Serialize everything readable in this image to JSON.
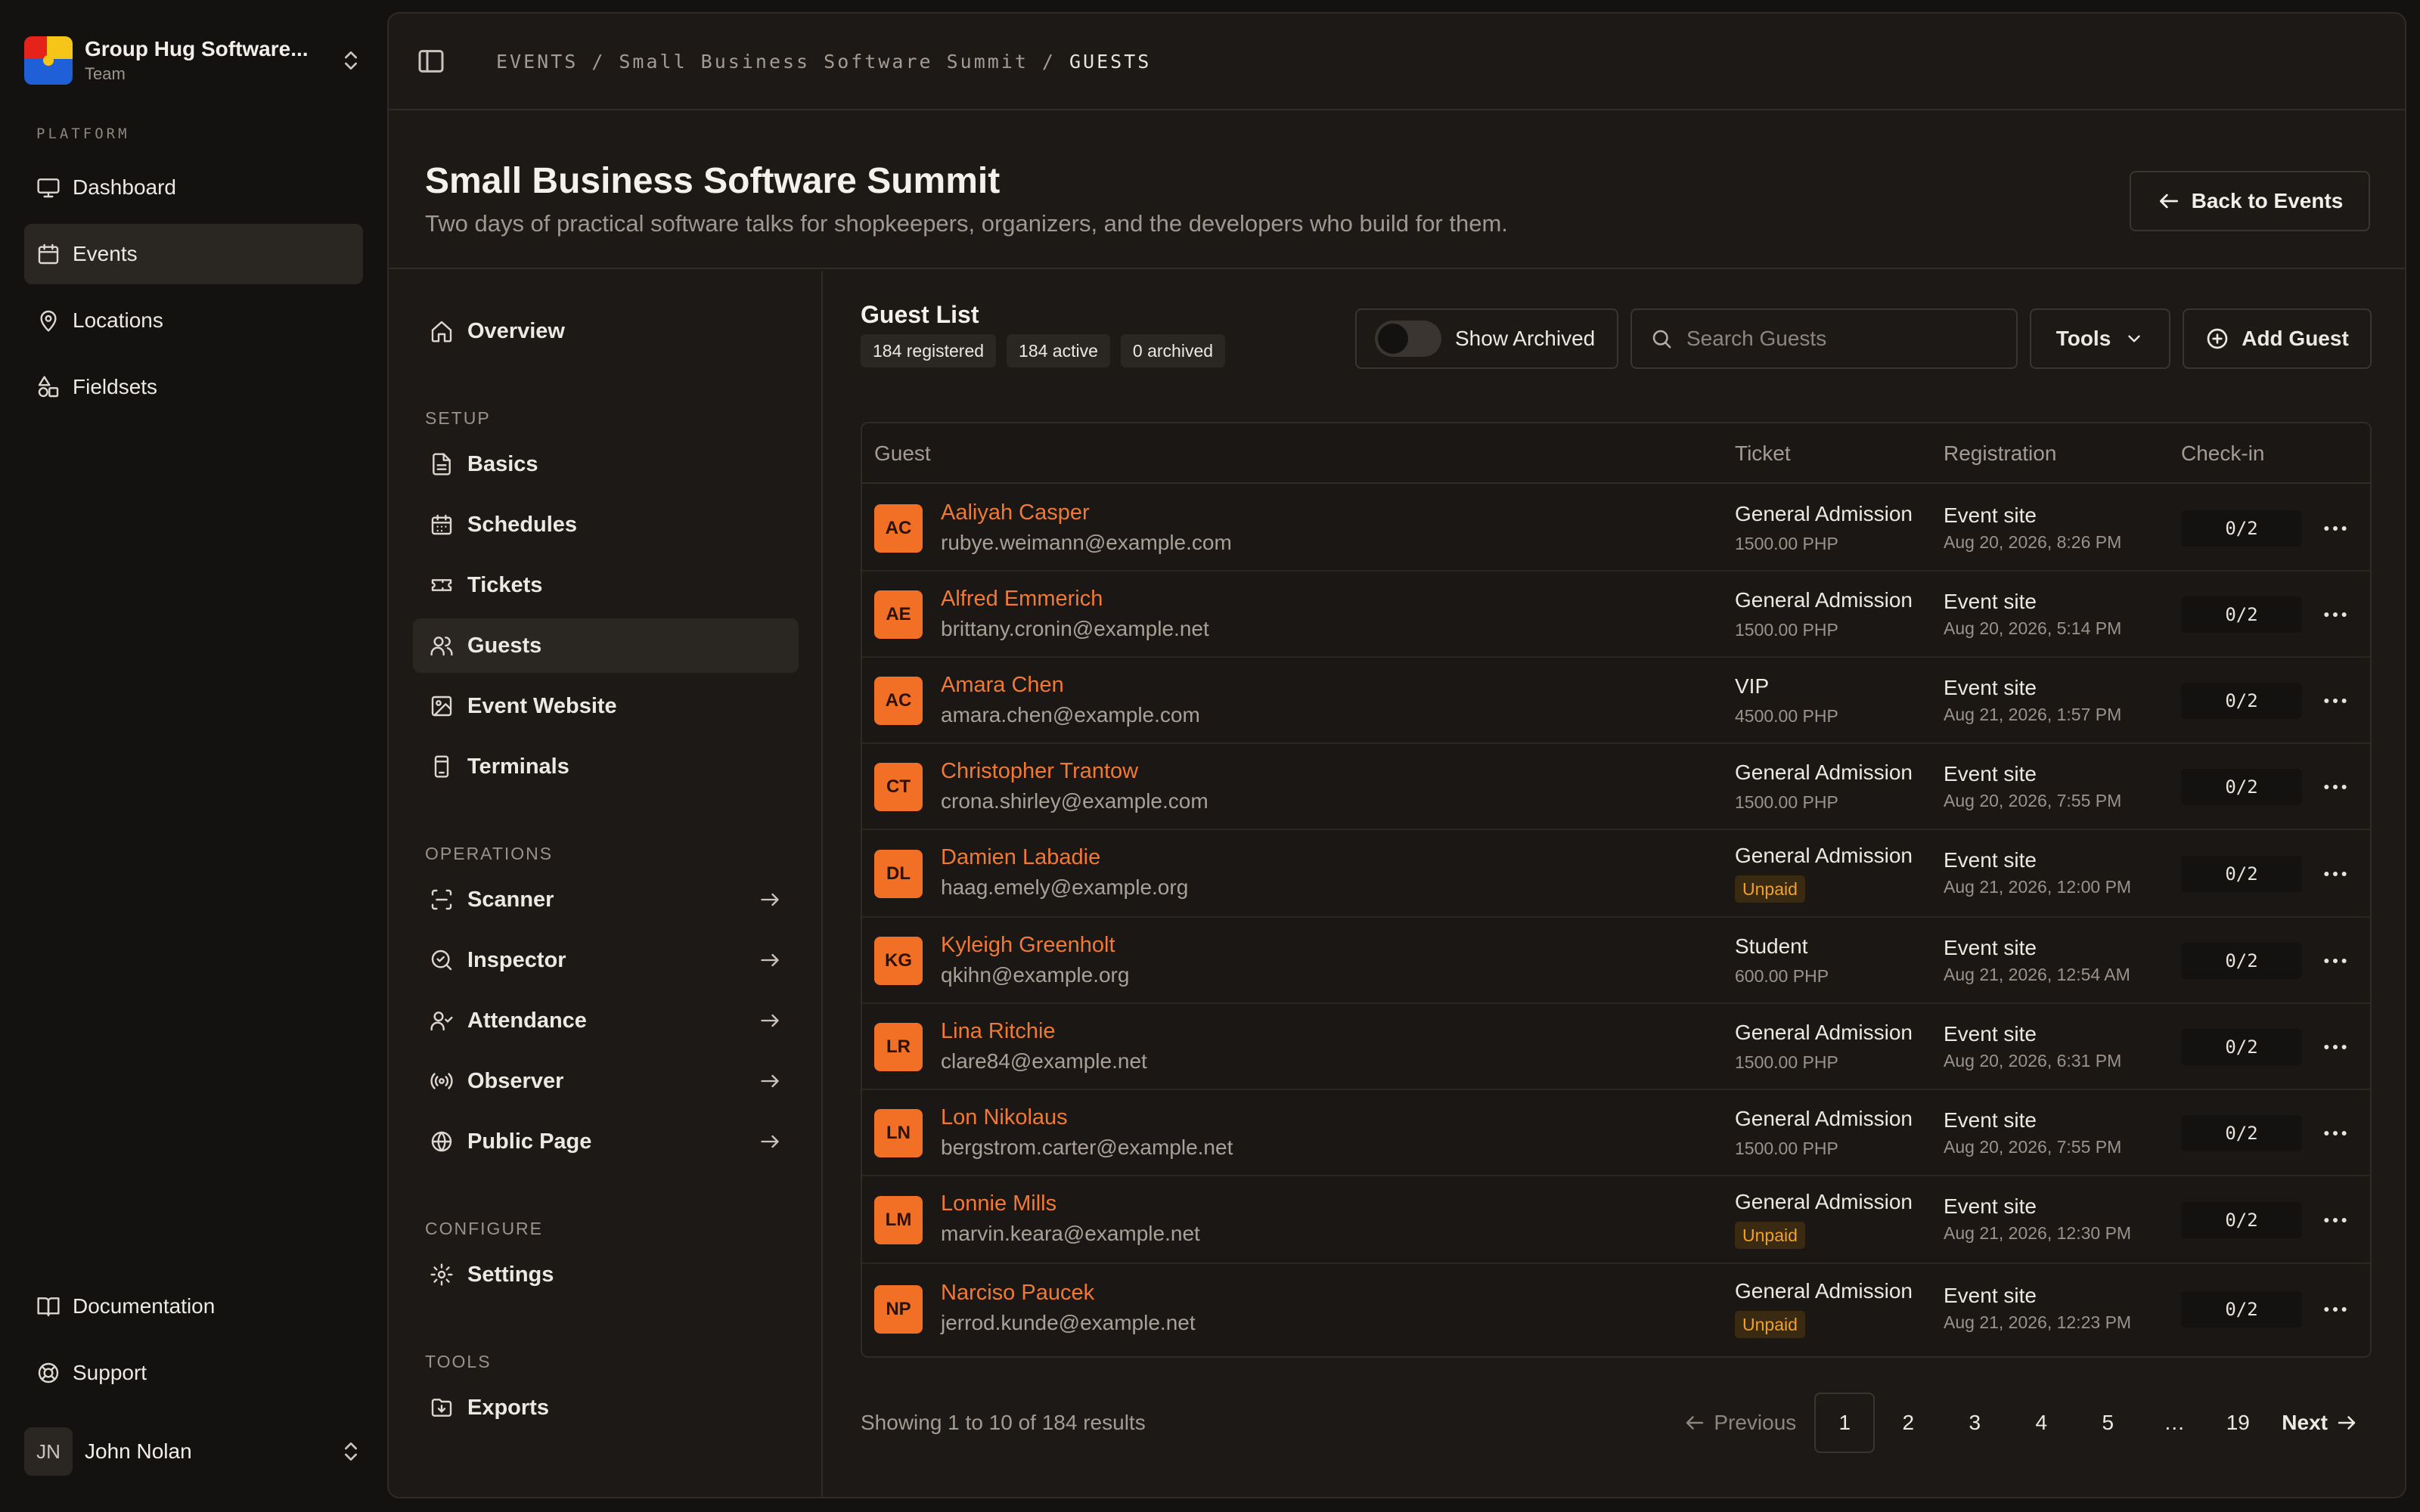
{
  "team": {
    "name": "Group Hug Software...",
    "sub": "Team"
  },
  "sidebar": {
    "section": "PLATFORM",
    "items": [
      {
        "label": "Dashboard",
        "icon": "monitor-icon"
      },
      {
        "label": "Events",
        "icon": "calendar-icon",
        "active": true
      },
      {
        "label": "Locations",
        "icon": "map-pin-icon"
      },
      {
        "label": "Fieldsets",
        "icon": "shapes-icon"
      }
    ],
    "footer": [
      {
        "label": "Documentation",
        "icon": "book-icon"
      },
      {
        "label": "Support",
        "icon": "lifebuoy-icon"
      }
    ]
  },
  "user": {
    "initials": "JN",
    "name": "John Nolan"
  },
  "breadcrumb": {
    "root": "EVENTS",
    "sep": "/",
    "event": "Small Business Software Summit",
    "current": "GUESTS"
  },
  "page": {
    "title": "Small Business Software Summit",
    "subtitle": "Two days of practical software talks for shopkeepers, organizers, and the developers who build for them.",
    "back_label": "Back to Events"
  },
  "subnav": {
    "overview": "Overview",
    "setup_label": "SETUP",
    "setup": [
      "Basics",
      "Schedules",
      "Tickets",
      "Guests",
      "Event Website",
      "Terminals"
    ],
    "operations_label": "OPERATIONS",
    "operations": [
      "Scanner",
      "Inspector",
      "Attendance",
      "Observer",
      "Public Page"
    ],
    "configure_label": "CONFIGURE",
    "configure": [
      "Settings"
    ],
    "tools_label": "TOOLS",
    "tools": [
      "Exports"
    ]
  },
  "guest_list": {
    "title": "Guest List",
    "registered": "184 registered",
    "active": "184 active",
    "archived": "0 archived",
    "show_archived": "Show Archived",
    "show_archived_on": false,
    "search_placeholder": "Search Guests",
    "tools_label": "Tools",
    "add_label": "Add Guest",
    "columns": {
      "guest": "Guest",
      "ticket": "Ticket",
      "registration": "Registration",
      "checkin": "Check-in"
    },
    "rows": [
      {
        "initials": "AC",
        "name": "Aaliyah Casper",
        "email": "rubye.weimann@example.com",
        "ticket": "General Admission",
        "price": "1500.00 PHP",
        "unpaid": "",
        "source": "Event site",
        "date": "Aug 20, 2026, 8:26 PM",
        "checkin": "0/2"
      },
      {
        "initials": "AE",
        "name": "Alfred Emmerich",
        "email": "brittany.cronin@example.net",
        "ticket": "General Admission",
        "price": "1500.00 PHP",
        "unpaid": "",
        "source": "Event site",
        "date": "Aug 20, 2026, 5:14 PM",
        "checkin": "0/2"
      },
      {
        "initials": "AC",
        "name": "Amara Chen",
        "email": "amara.chen@example.com",
        "ticket": "VIP",
        "price": "4500.00 PHP",
        "unpaid": "",
        "source": "Event site",
        "date": "Aug 21, 2026, 1:57 PM",
        "checkin": "0/2"
      },
      {
        "initials": "CT",
        "name": "Christopher Trantow",
        "email": "crona.shirley@example.com",
        "ticket": "General Admission",
        "price": "1500.00 PHP",
        "unpaid": "",
        "source": "Event site",
        "date": "Aug 20, 2026, 7:55 PM",
        "checkin": "0/2"
      },
      {
        "initials": "DL",
        "name": "Damien Labadie",
        "email": "haag.emely@example.org",
        "ticket": "General Admission",
        "price": "",
        "unpaid": "Unpaid",
        "source": "Event site",
        "date": "Aug 21, 2026, 12:00 PM",
        "checkin": "0/2"
      },
      {
        "initials": "KG",
        "name": "Kyleigh Greenholt",
        "email": "qkihn@example.org",
        "ticket": "Student",
        "price": "600.00 PHP",
        "unpaid": "",
        "source": "Event site",
        "date": "Aug 21, 2026, 12:54 AM",
        "checkin": "0/2"
      },
      {
        "initials": "LR",
        "name": "Lina Ritchie",
        "email": "clare84@example.net",
        "ticket": "General Admission",
        "price": "1500.00 PHP",
        "unpaid": "",
        "source": "Event site",
        "date": "Aug 20, 2026, 6:31 PM",
        "checkin": "0/2"
      },
      {
        "initials": "LN",
        "name": "Lon Nikolaus",
        "email": "bergstrom.carter@example.net",
        "ticket": "General Admission",
        "price": "1500.00 PHP",
        "unpaid": "",
        "source": "Event site",
        "date": "Aug 20, 2026, 7:55 PM",
        "checkin": "0/2"
      },
      {
        "initials": "LM",
        "name": "Lonnie Mills",
        "email": "marvin.keara@example.net",
        "ticket": "General Admission",
        "price": "",
        "unpaid": "Unpaid",
        "source": "Event site",
        "date": "Aug 21, 2026, 12:30 PM",
        "checkin": "0/2"
      },
      {
        "initials": "NP",
        "name": "Narciso Paucek",
        "email": "jerrod.kunde@example.net",
        "ticket": "General Admission",
        "price": "",
        "unpaid": "Unpaid",
        "source": "Event site",
        "date": "Aug 21, 2026, 12:23 PM",
        "checkin": "0/2"
      }
    ]
  },
  "pagination": {
    "summary": "Showing 1 to 10 of 184 results",
    "previous": "Previous",
    "pages": [
      "1",
      "2",
      "3",
      "4",
      "5"
    ],
    "ellipsis": "…",
    "last": "19",
    "next": "Next",
    "current": "1"
  },
  "colors": {
    "accent": "#f26f26",
    "unpaid": "#f0a12c",
    "background": "#141210",
    "panel": "#1c1916"
  }
}
